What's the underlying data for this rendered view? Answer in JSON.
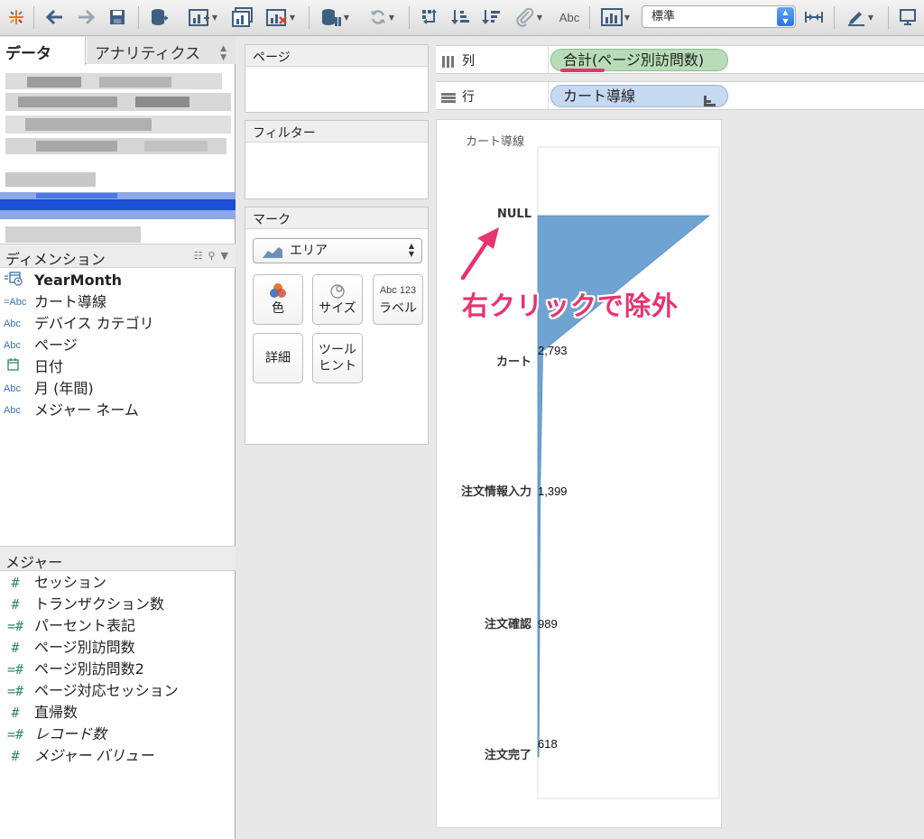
{
  "toolbar": {
    "icons": [
      "tableau-logo-icon",
      "back-icon",
      "forward-icon",
      "save-icon",
      "new-datasource-icon",
      "new-worksheet-icon",
      "duplicate-sheet-icon",
      "clear-sheet-icon",
      "pause-updates-icon",
      "refresh-icon",
      "swap-icon",
      "sort-ascending-icon",
      "sort-descending-icon",
      "highlight-icon",
      "text-label-icon",
      "show-me-icon",
      "fix-axes-icon",
      "format-icon",
      "presentation-icon"
    ],
    "abc_label": "Abc",
    "fit_value": "標準"
  },
  "left_panel": {
    "tab_data": "データ",
    "tab_analytics": "アナリティクス",
    "dimensions_header": "ディメンション",
    "dimensions": [
      {
        "icon": "date-calc-icon",
        "icon_text": "",
        "name": "YearMonth",
        "bold": true
      },
      {
        "icon": "calc-string-icon",
        "icon_text": "=Abc",
        "name": "カート導線",
        "bold": false
      },
      {
        "icon": "string-icon",
        "icon_text": "Abc",
        "name": "デバイス カテゴリ",
        "bold": false
      },
      {
        "icon": "string-icon",
        "icon_text": "Abc",
        "name": "ページ",
        "bold": false
      },
      {
        "icon": "date-icon",
        "icon_text": "",
        "name": "日付",
        "bold": false
      },
      {
        "icon": "string-icon",
        "icon_text": "Abc",
        "name": "月 (年間)",
        "bold": false
      },
      {
        "icon": "string-icon",
        "icon_text": "Abc",
        "name": "メジャー ネーム",
        "bold": false
      }
    ],
    "measures_header": "メジャー",
    "measures": [
      {
        "icon_text": "#",
        "name": "セッション",
        "italic": false
      },
      {
        "icon_text": "#",
        "name": "トランザクション数",
        "italic": false
      },
      {
        "icon_text": "=#",
        "name": "パーセント表記",
        "italic": false
      },
      {
        "icon_text": "#",
        "name": "ページ別訪問数",
        "italic": false
      },
      {
        "icon_text": "=#",
        "name": "ページ別訪問数2",
        "italic": false
      },
      {
        "icon_text": "=#",
        "name": "ページ対応セッション",
        "italic": false
      },
      {
        "icon_text": "#",
        "name": "直帰数",
        "italic": false
      },
      {
        "icon_text": "=#",
        "name": "レコード数",
        "italic": true
      },
      {
        "icon_text": "#",
        "name": "メジャー バリュー",
        "italic": true
      }
    ]
  },
  "cards": {
    "pages_title": "ページ",
    "filters_title": "フィルター",
    "marks_title": "マーク",
    "mark_type": "エリア",
    "color_label": "色",
    "size_label": "サイズ",
    "label_label": "ラベル",
    "label_icon_text": "Abc 123",
    "detail_label": "詳細",
    "tooltip_label_1": "ツール",
    "tooltip_label_2": "ヒント"
  },
  "shelves": {
    "columns_label": "列",
    "columns_pill": "合計(ページ別訪問数)",
    "rows_label": "行",
    "rows_pill": "カート導線"
  },
  "view": {
    "header": "カート導線"
  },
  "annotation": {
    "text": "右クリックで除外",
    "color": "#e8336e"
  },
  "chart_data": {
    "type": "area",
    "orientation": "horizontal",
    "categories": [
      "NULL",
      "カート",
      "注文情報入力",
      "注文確認",
      "注文完了"
    ],
    "values": [
      95000,
      2793,
      1399,
      989,
      618
    ],
    "value_labels": [
      "",
      "2,793",
      "1,399",
      "989",
      "618"
    ],
    "color": "#6fa3d1",
    "xlabel": "",
    "ylabel": "カート導線"
  }
}
